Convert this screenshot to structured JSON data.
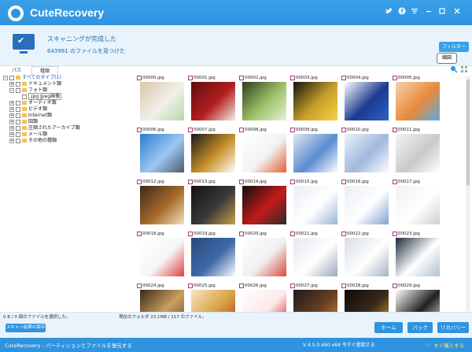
{
  "app": {
    "title": "CuteRecovery"
  },
  "status": {
    "title": "スキャニングが完成した",
    "subtitle": "643981 のファイルを見つけた",
    "filter_label": "フィルター",
    "tooltip": "縮図"
  },
  "tabs": [
    {
      "label": "パス"
    },
    {
      "label": "種類"
    }
  ],
  "tree": [
    {
      "label": "すべてのタイプ(1)",
      "color": "#2a4dc9"
    },
    {
      "label": "ドキュメント類"
    },
    {
      "label": "フォト類"
    },
    {
      "label": ".jpg Jpeg画像"
    },
    {
      "label": "オーディオ類"
    },
    {
      "label": "ビデオ類"
    },
    {
      "label": "Internet類"
    },
    {
      "label": "図類"
    },
    {
      "label": "圧縮されたアーカイブ類"
    },
    {
      "label": "メール類"
    },
    {
      "label": "その他の種類"
    }
  ],
  "files": [
    {
      "name": "00000.jpg",
      "colors": [
        "#d8c8a8",
        "#f2efe9",
        "#b9d7a8"
      ]
    },
    {
      "name": "00001.jpg",
      "colors": [
        "#5a0f0f",
        "#b51e1e",
        "#f3f0e8"
      ]
    },
    {
      "name": "00002.jpg",
      "colors": [
        "#2c3e1e",
        "#9ec36a",
        "#e8f0d8"
      ]
    },
    {
      "name": "00003.jpg",
      "colors": [
        "#111111",
        "#c8a02a",
        "#f7d142"
      ]
    },
    {
      "name": "00004.jpg",
      "colors": [
        "#ffffff",
        "#1b3a8f",
        "#2f63c4"
      ]
    },
    {
      "name": "00005.jpg",
      "colors": [
        "#f6d0b0",
        "#e88a3b",
        "#5aa9e6"
      ]
    },
    {
      "name": "00006.jpg",
      "colors": [
        "#2b7bd3",
        "#9bc7f0",
        "#4e5d6e"
      ]
    },
    {
      "name": "00007.jpg",
      "colors": [
        "#1a1a1a",
        "#c8902a",
        "#ffffff"
      ]
    },
    {
      "name": "00008.jpg",
      "colors": [
        "#ffffff",
        "#f2f2f2",
        "#e06030"
      ]
    },
    {
      "name": "00009.jpg",
      "colors": [
        "#dfe8f4",
        "#5b8bd1",
        "#ffffff"
      ]
    },
    {
      "name": "00010.jpg",
      "colors": [
        "#eaf1fb",
        "#9fb9dc",
        "#ffffff"
      ]
    },
    {
      "name": "00011.jpg",
      "colors": [
        "#f4f4f4",
        "#c9c9c9",
        "#ffffff"
      ]
    },
    {
      "name": "00012.jpg",
      "colors": [
        "#3a2a1a",
        "#a86a2a",
        "#f1e0c0"
      ]
    },
    {
      "name": "00013.jpg",
      "colors": [
        "#111111",
        "#3a3a3a",
        "#c8a04a"
      ]
    },
    {
      "name": "00014.jpg",
      "colors": [
        "#101010",
        "#c21a1a",
        "#2a2a2a"
      ]
    },
    {
      "name": "00015.jpg",
      "colors": [
        "#e9eef5",
        "#ffffff",
        "#9cb5d6"
      ]
    },
    {
      "name": "00016.jpg",
      "colors": [
        "#e9eef5",
        "#ffffff",
        "#7fa2d0"
      ]
    },
    {
      "name": "00017.jpg",
      "colors": [
        "#f2f2f2",
        "#ffffff",
        "#d0d0d0"
      ]
    },
    {
      "name": "00018.jpg",
      "colors": [
        "#ffffff",
        "#f6f6f6",
        "#e04040"
      ]
    },
    {
      "name": "00019.jpg",
      "colors": [
        "#2a4a7a",
        "#3d6aa8",
        "#ffffff"
      ]
    },
    {
      "name": "00020.jpg",
      "colors": [
        "#ffffff",
        "#efefef",
        "#d84a3a"
      ]
    },
    {
      "name": "00021.jpg",
      "colors": [
        "#e4e8ee",
        "#ffffff",
        "#9aa8bc"
      ]
    },
    {
      "name": "00022.jpg",
      "colors": [
        "#d7dce4",
        "#ffffff",
        "#a8b4c6"
      ]
    },
    {
      "name": "00023.jpg",
      "colors": [
        "#1a2a3a",
        "#ffffff",
        "#b0c0d0"
      ]
    },
    {
      "name": "00024.jpg",
      "colors": [
        "#3a2a1a",
        "#c8a060",
        "#6a4a2a"
      ]
    },
    {
      "name": "00025.jpg",
      "colors": [
        "#f5e6c8",
        "#d8a040",
        "#b04020"
      ]
    },
    {
      "name": "00026.jpg",
      "colors": [
        "#ffffff",
        "#fde8e8",
        "#d02020"
      ]
    },
    {
      "name": "00027.jpg",
      "colors": [
        "#1a1a1a",
        "#6a4020",
        "#d09040"
      ]
    },
    {
      "name": "00028.jpg",
      "colors": [
        "#0a0a0a",
        "#3a2a1a",
        "#e0a040"
      ]
    },
    {
      "name": "00029.jpg",
      "colors": [
        "#ffffff",
        "#202020",
        "#f0f0f0"
      ]
    }
  ],
  "footer": {
    "selected_text": "0 B / 0 個のファイルを選択した。",
    "folder_text": "現在のフォルダ 23.1MB / 117 のファイル。",
    "save_label": "スキャン結果の保存",
    "home_label": "ホーム",
    "back_label": "バック",
    "recover_label": "リカバリー"
  },
  "bottombar": {
    "tagline": "CuteRecovery - パーティションとファイルを復元する",
    "version": "V 4.5.0.460 x64   今すぐ登録する",
    "buy_label": "すぐ購入する"
  },
  "colors": {
    "accent": "#2f93df",
    "highlight": "#2a4dc9"
  }
}
